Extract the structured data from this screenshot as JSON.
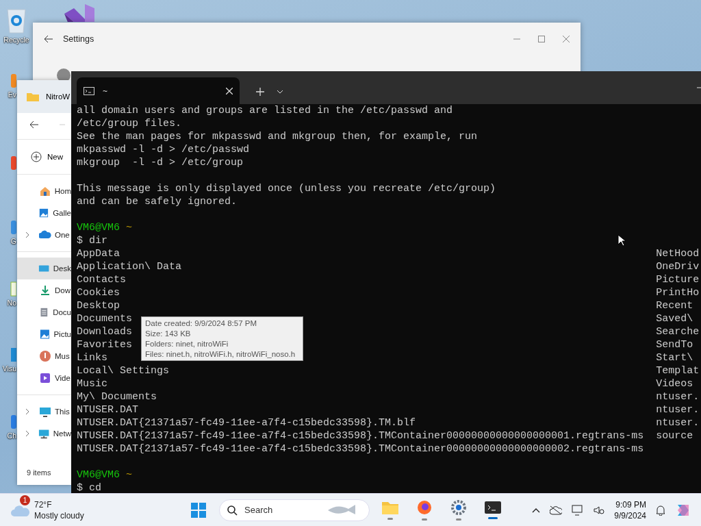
{
  "desktop": {
    "icons": [
      {
        "kind": "recycle-bin",
        "label": "Recycle"
      },
      {
        "kind": "studio"
      },
      {
        "kind": "app-orange",
        "label": "Ev"
      },
      {
        "kind": "app-red"
      },
      {
        "kind": "app-blue",
        "label": "G"
      },
      {
        "kind": "app-notepad",
        "label": "No"
      },
      {
        "kind": "app-code",
        "label": "Visu"
      },
      {
        "kind": "app-chrome",
        "label": "Ch"
      }
    ]
  },
  "settings": {
    "title": "Settings"
  },
  "explorer": {
    "title": "NitroW",
    "new_button": "New",
    "nav_sections": [
      {
        "items": [
          {
            "kind": "home",
            "label": "Hom",
            "expandable": false,
            "selected": false
          },
          {
            "kind": "gallery",
            "label": "Galle",
            "expandable": false,
            "selected": false
          },
          {
            "kind": "cloud",
            "label": "One",
            "expandable": true,
            "selected": false
          }
        ]
      },
      {
        "items": [
          {
            "kind": "desktop",
            "label": "Desk",
            "expandable": false,
            "selected": true
          },
          {
            "kind": "download",
            "label": "Dow",
            "expandable": false,
            "selected": false
          },
          {
            "kind": "document",
            "label": "Docu",
            "expandable": false,
            "selected": false
          },
          {
            "kind": "pictures",
            "label": "Pictu",
            "expandable": false,
            "selected": false
          },
          {
            "kind": "music",
            "label": "Mus",
            "expandable": false,
            "selected": false
          },
          {
            "kind": "video",
            "label": "Vide",
            "expandable": false,
            "selected": false
          }
        ]
      },
      {
        "items": [
          {
            "kind": "pc",
            "label": "This",
            "expandable": true,
            "selected": false
          },
          {
            "kind": "network",
            "label": "Netw",
            "expandable": true,
            "selected": false
          }
        ]
      }
    ],
    "status": "9 items"
  },
  "terminal": {
    "tab_title": "~",
    "lines": [
      {
        "kind": "text",
        "text": "all domain users and groups are listed in the /etc/passwd and"
      },
      {
        "kind": "text",
        "text": "/etc/group files."
      },
      {
        "kind": "text",
        "text": "See the man pages for mkpasswd and mkgroup then, for example, run"
      },
      {
        "kind": "text",
        "text": "mkpasswd -l -d > /etc/passwd"
      },
      {
        "kind": "text",
        "text": "mkgroup  -l -d > /etc/group"
      },
      {
        "kind": "blank"
      },
      {
        "kind": "text",
        "text": "This message is only displayed once (unless you recreate /etc/group)"
      },
      {
        "kind": "text",
        "text": "and can be safely ignored."
      },
      {
        "kind": "blank"
      },
      {
        "kind": "prompt",
        "user": "VM6@VM6",
        "path": "~"
      },
      {
        "kind": "text",
        "text": "$ dir"
      },
      {
        "kind": "listing",
        "column_1": "AppData",
        "column_2": "NetHood"
      },
      {
        "kind": "listing",
        "column_1": "Application\\ Data",
        "column_2": "OneDriv"
      },
      {
        "kind": "listing",
        "column_1": "Contacts",
        "column_2": "Picture"
      },
      {
        "kind": "listing",
        "column_1": "Cookies",
        "column_2": "PrintHo"
      },
      {
        "kind": "listing",
        "column_1": "Desktop",
        "column_2": "Recent"
      },
      {
        "kind": "listing",
        "column_1": "Documents",
        "column_2": "Saved\\"
      },
      {
        "kind": "listing",
        "column_1": "Downloads",
        "column_2": "Searche"
      },
      {
        "kind": "listing",
        "column_1": "Favorites",
        "column_2": "SendTo"
      },
      {
        "kind": "listing",
        "column_1": "Links",
        "column_2": "Start\\"
      },
      {
        "kind": "listing",
        "column_1": "Local\\ Settings",
        "column_2": "Templat"
      },
      {
        "kind": "listing",
        "column_1": "Music",
        "column_2": "Videos"
      },
      {
        "kind": "listing",
        "column_1": "My\\ Documents",
        "column_2": "ntuser."
      },
      {
        "kind": "listing",
        "column_1": "NTUSER.DAT",
        "column_2": "ntuser."
      },
      {
        "kind": "listing",
        "column_1": "NTUSER.DAT{21371a57-fc49-11ee-a7f4-c15bedc33598}.TM.blf",
        "column_2": "ntuser."
      },
      {
        "kind": "listing",
        "column_1": "NTUSER.DAT{21371a57-fc49-11ee-a7f4-c15bedc33598}.TMContainer00000000000000000001.regtrans-ms",
        "column_2": "source"
      },
      {
        "kind": "listing",
        "column_1": "NTUSER.DAT{21371a57-fc49-11ee-a7f4-c15bedc33598}.TMContainer00000000000000000002.regtrans-ms"
      },
      {
        "kind": "blank"
      },
      {
        "kind": "prompt",
        "user": "VM6@VM6",
        "path": "~"
      },
      {
        "kind": "text",
        "text": "$ cd"
      }
    ]
  },
  "tooltip": {
    "lines": [
      "Date created: 9/9/2024 8:57 PM",
      "Size: 143 KB",
      "Folders: ninet, nitroWiFi",
      "Files: ninet.h, nitroWiFi.h, nitroWiFi_noso.h"
    ]
  },
  "taskbar": {
    "weather": {
      "badge": "1",
      "temperature": "72°F",
      "condition": "Mostly cloudy"
    },
    "search": {
      "placeholder": "Search"
    },
    "apps": [
      {
        "kind": "explorer",
        "selected": false
      },
      {
        "kind": "browser",
        "selected": false
      },
      {
        "kind": "settings",
        "selected": false
      },
      {
        "kind": "terminal",
        "selected": true
      }
    ],
    "clock": {
      "time": "9:09 PM",
      "date": "9/9/2024"
    }
  }
}
